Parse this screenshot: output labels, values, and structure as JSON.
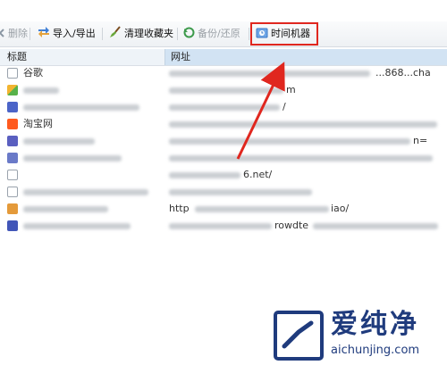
{
  "toolbar": {
    "delete_label": "删除",
    "import_export_label": "导入/导出",
    "clean_favorites_label": "清理收藏夹",
    "backup_restore_label": "备份/还原",
    "time_machine_label": "时间机器"
  },
  "columns": {
    "name": "标题",
    "url": "网址"
  },
  "rows": [
    {
      "icon": "page-icon",
      "name": "谷歌",
      "url": "h...",
      "url_tail": "...868...cha",
      "name_blur": 0,
      "url_blur": 300
    },
    {
      "icon": "colorful-site-icon",
      "name": "",
      "url": "",
      "url_tail": "m",
      "name_blur": 40,
      "url_blur": 140
    },
    {
      "icon": "blue-site-icon",
      "name": "",
      "url": "",
      "url_tail": "/",
      "name_blur": 130,
      "url_blur": 130
    },
    {
      "icon": "taobao-icon",
      "name": "淘宝网",
      "url": "",
      "url_tail": "",
      "name_blur": 0,
      "url_blur": 300
    },
    {
      "icon": "blue-site-icon",
      "name": "",
      "url": "",
      "url_tail": "n=",
      "name_blur": 80,
      "url_blur": 300
    },
    {
      "icon": "blue-site-icon",
      "name": "",
      "url": "",
      "url_tail": "",
      "name_blur": 110,
      "url_blur": 295
    },
    {
      "icon": "page-icon",
      "name": "",
      "url": "",
      "url_tail": "6.net/",
      "name_blur": 0,
      "url_blur": 100
    },
    {
      "icon": "page-icon",
      "name": "",
      "url": "",
      "url_tail": "",
      "name_blur": 140,
      "url_blur": 160
    },
    {
      "icon": "orange-site-icon",
      "name": "",
      "url": "http",
      "url_tail": "iao/",
      "name_blur": 95,
      "url_blur": 150
    },
    {
      "icon": "blue-site-icon",
      "name": "",
      "url": "",
      "url_tail": "rowdte",
      "name_blur": 130,
      "url_blur": 300
    }
  ],
  "watermark": {
    "title": "爱纯净",
    "url": "aichunjing.com"
  },
  "colors": {
    "highlight": "#e0271f",
    "header_url_bg": "#d2e3f3",
    "watermark": "#1f3b7d"
  }
}
